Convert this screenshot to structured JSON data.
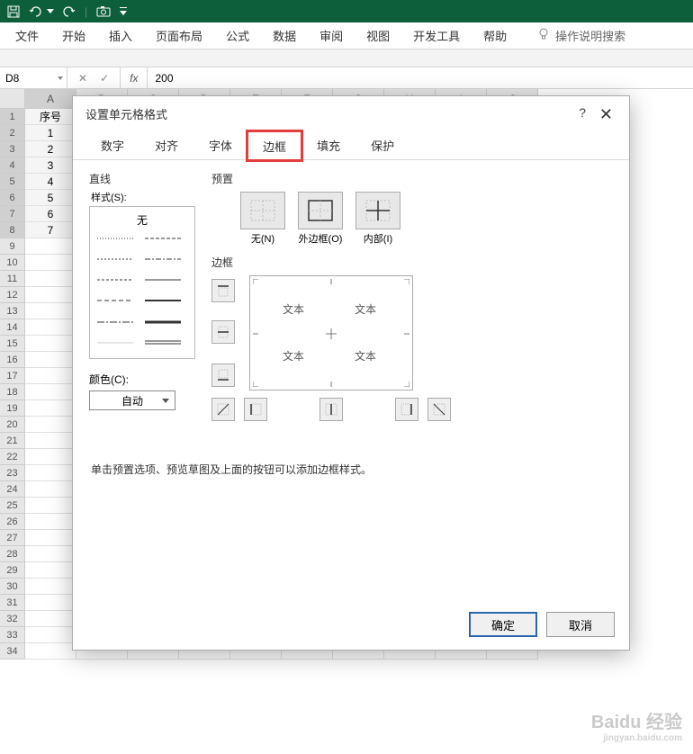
{
  "titlebar": {
    "icons": [
      "save",
      "undo",
      "redo",
      "camera",
      "dropdown"
    ]
  },
  "ribbon": {
    "tabs": [
      "文件",
      "开始",
      "插入",
      "页面布局",
      "公式",
      "数据",
      "审阅",
      "视图",
      "开发工具",
      "帮助"
    ],
    "tell_me": "操作说明搜索"
  },
  "formula_bar": {
    "name_box": "D8",
    "value": "200"
  },
  "sheet": {
    "columns": [
      "A",
      "B",
      "C",
      "D",
      "E",
      "F",
      "G",
      "H",
      "I",
      "J"
    ],
    "selected_col_index": 0,
    "row_count": 34,
    "visible_rows": [
      1,
      2,
      3,
      4,
      5,
      6,
      7,
      8,
      9,
      10,
      11,
      12,
      13,
      14,
      15,
      16,
      17,
      18,
      19,
      20,
      21,
      22,
      23,
      24,
      25,
      26,
      27,
      28,
      29,
      30,
      31,
      32,
      33,
      34
    ],
    "selected_rows": [
      1,
      2,
      3,
      4,
      5,
      6,
      7,
      8
    ],
    "data": {
      "A1": "序号",
      "A2": "1",
      "A3": "2",
      "A4": "3",
      "A5": "4",
      "A6": "5",
      "A7": "6",
      "A8": "7"
    }
  },
  "dialog": {
    "title": "设置单元格格式",
    "help": "?",
    "close": "✕",
    "tabs": [
      "数字",
      "对齐",
      "字体",
      "边框",
      "填充",
      "保护"
    ],
    "active_tab_index": 3,
    "line_section": "直线",
    "style_label": "样式(S):",
    "style_none": "无",
    "color_label": "颜色(C):",
    "color_value": "自动",
    "preset_section": "预置",
    "presets": [
      {
        "key": "none",
        "label": "无(N)"
      },
      {
        "key": "outline",
        "label": "外边框(O)"
      },
      {
        "key": "inside",
        "label": "内部(I)"
      }
    ],
    "border_section": "边框",
    "preview_text": "文本",
    "hint": "单击预置选项、预览草图及上面的按钮可以添加边框样式。",
    "ok": "确定",
    "cancel": "取消"
  },
  "watermark": {
    "brand": "Baidu 经验",
    "sub": "jingyan.baidu.com"
  }
}
